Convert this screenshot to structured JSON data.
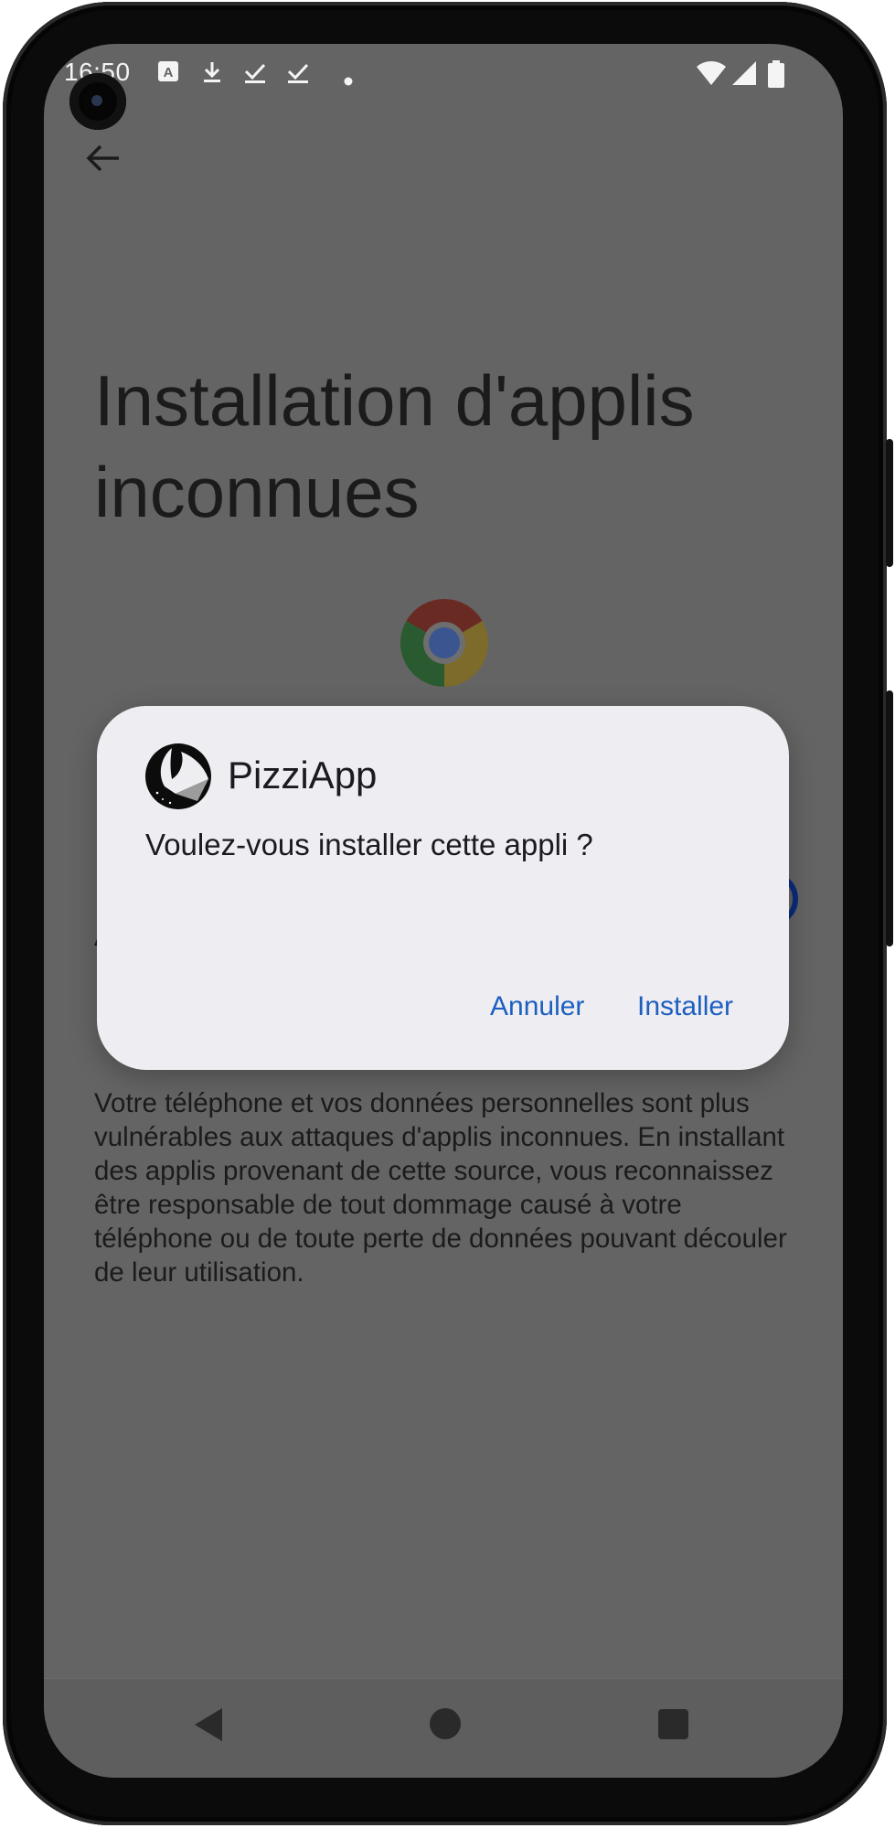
{
  "status_bar": {
    "time": "16:50",
    "left_icons": [
      "translate-icon",
      "download-icon",
      "check-icon",
      "check-icon",
      "dot-icon"
    ],
    "right_icons": [
      "wifi-icon",
      "signal-icon",
      "battery-icon"
    ]
  },
  "page": {
    "title": "Installation d'applis inconnues",
    "source_app_icon": "chrome-icon",
    "row_label": "A",
    "warning_text": "Votre téléphone et vos données personnelles sont plus vulnérables aux attaques d'applis inconnues. En installant des applis provenant de cette source, vous reconnaissez être responsable de tout dommage causé à votre téléphone ou de toute perte de données pouvant découler de leur utilisation."
  },
  "dialog": {
    "app_name": "PizziApp",
    "message": "Voulez-vous installer cette appli ?",
    "cancel_label": "Annuler",
    "install_label": "Installer",
    "accent_color": "#1c5fc1"
  },
  "nav_bar": {
    "buttons": [
      "back",
      "home",
      "recent-apps"
    ]
  }
}
